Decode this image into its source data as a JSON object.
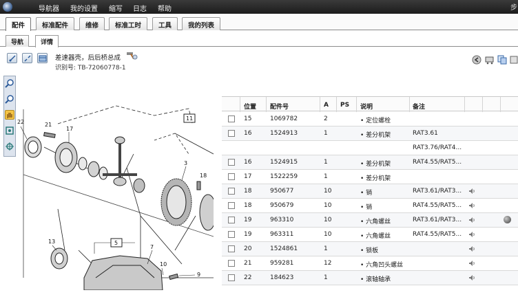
{
  "menubar": {
    "items": [
      "导航器",
      "我的设置",
      "缩写",
      "日志",
      "帮助"
    ],
    "edge_char": "步"
  },
  "main_tabs": [
    "配件",
    "标准配件",
    "维修",
    "标准工时",
    "工具",
    "我的列表"
  ],
  "sub_tabs": [
    "导航",
    "详情"
  ],
  "part": {
    "title": "差速器壳，后后桥总成",
    "id_label": "识别号: TB-72060778-1"
  },
  "drawing": {
    "callouts": [
      "22",
      "21",
      "17",
      "11",
      "3",
      "18",
      "13",
      "5",
      "7",
      "10",
      "9"
    ]
  },
  "table": {
    "headers": [
      "位置",
      "配件号",
      "A",
      "PS",
      "说明",
      "备注"
    ],
    "rows": [
      {
        "pos": "15",
        "part": "1069782",
        "a": "2",
        "desc": "• 定位螺栓",
        "note": "",
        "speaker": false,
        "info": false,
        "check": true
      },
      {
        "pos": "16",
        "part": "1524913",
        "a": "1",
        "desc": "• 差分机架",
        "note": "RAT3.61",
        "speaker": false,
        "info": false,
        "check": true
      },
      {
        "pos": "",
        "part": "",
        "a": "",
        "desc": "",
        "note": "RAT3.76/RAT4...",
        "speaker": false,
        "info": false,
        "check": false
      },
      {
        "pos": "16",
        "part": "1524915",
        "a": "1",
        "desc": "• 差分机架",
        "note": "RAT4.55/RAT5...",
        "speaker": false,
        "info": false,
        "check": true
      },
      {
        "pos": "17",
        "part": "1522259",
        "a": "1",
        "desc": "• 差分机架",
        "note": "",
        "speaker": false,
        "info": false,
        "check": true
      },
      {
        "pos": "18",
        "part": "950677",
        "a": "10",
        "desc": "• 销",
        "note": "RAT3.61/RAT3...",
        "speaker": true,
        "info": false,
        "check": true
      },
      {
        "pos": "18",
        "part": "950679",
        "a": "10",
        "desc": "• 销",
        "note": "RAT4.55/RAT5...",
        "speaker": true,
        "info": false,
        "check": true
      },
      {
        "pos": "19",
        "part": "963310",
        "a": "10",
        "desc": "• 六角螺丝",
        "note": "RAT3.61/RAT3...",
        "speaker": true,
        "info": true,
        "check": true
      },
      {
        "pos": "19",
        "part": "963311",
        "a": "10",
        "desc": "• 六角螺丝",
        "note": "RAT4.55/RAT5...",
        "speaker": true,
        "info": false,
        "check": true
      },
      {
        "pos": "20",
        "part": "1524861",
        "a": "1",
        "desc": "• 锁板",
        "note": "",
        "speaker": true,
        "info": false,
        "check": true
      },
      {
        "pos": "21",
        "part": "959281",
        "a": "12",
        "desc": "• 六角凹头螺丝",
        "note": "",
        "speaker": true,
        "info": false,
        "check": true
      },
      {
        "pos": "22",
        "part": "184623",
        "a": "1",
        "desc": "• 滚轴轴承",
        "note": "",
        "speaker": true,
        "info": false,
        "check": true
      }
    ]
  },
  "colors": {
    "menubar": "#2a2a2a",
    "selected_tool": "#f5c445"
  },
  "icons": [
    "zoom-in-icon",
    "zoom-out-icon",
    "hand-pan-icon",
    "fit-icon",
    "crosshair-icon",
    "speaker-icon",
    "info-icon",
    "hammer-icon"
  ]
}
